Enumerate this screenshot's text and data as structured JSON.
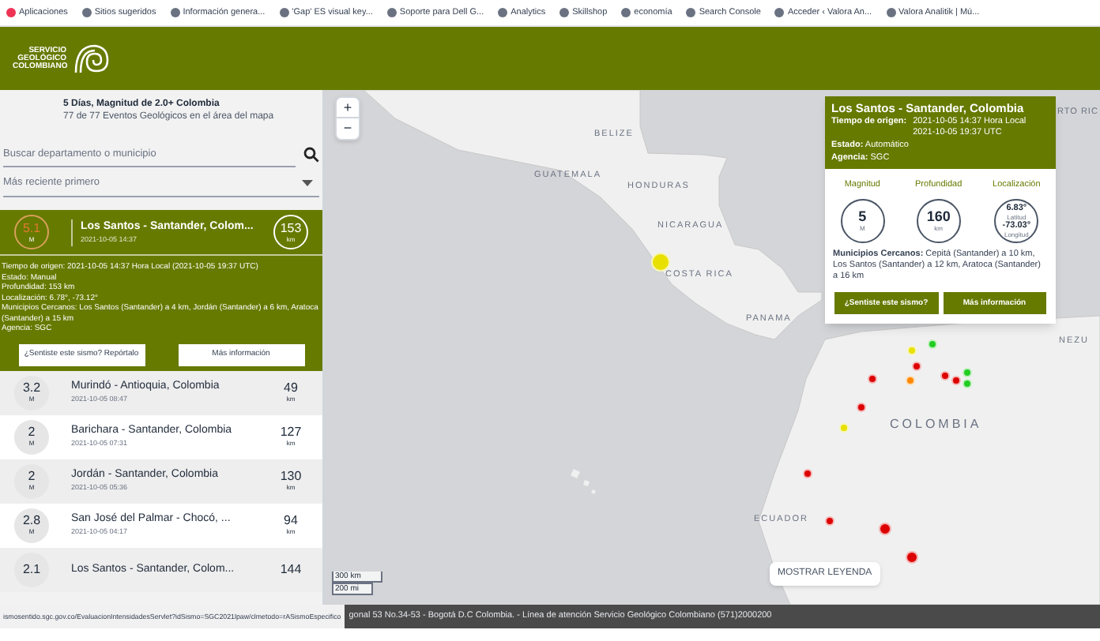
{
  "bookmarks": [
    "Aplicaciones",
    "Sitios sugeridos",
    "Información genera...",
    "'Gap' ES visual key...",
    "Soporte para Dell G...",
    "Analytics",
    "Skillshop",
    "economía",
    "Search Console",
    "Acceder ‹ Valora An...",
    "Valora Analitik | Mú..."
  ],
  "logo_text": "SERVICIO GEOLÓGICO COLOMBIANO",
  "sidebar": {
    "summary_title": "5 Días, Magnitud de 2.0+ Colombia",
    "summary_count": "77 de 77 Eventos Geológicos en el área del mapa",
    "search": {
      "placeholder": "Buscar departamento o municipio"
    },
    "sort": {
      "value": "Más reciente primero"
    },
    "events": [
      {
        "magnitude": "5.1",
        "unit": "M",
        "place": "Los Santos - Santander, Colom...",
        "time": "2021-10-05 14:37",
        "distance": "153",
        "distance_unit": "km",
        "selected": true,
        "details": [
          "Tiempo de origen: 2021-10-05 14:37 Hora Local (2021-10-05 19:37 UTC)",
          "Estado: Manual",
          "Profundidad: 153 km",
          "Localización: 6.78°, -73.12°",
          "Municipios Cercanos: Los Santos (Santander) a 4 km, Jordán (Santander) a 6 km, Aratoca (Santander) a 15 km",
          "Agencia: SGC"
        ],
        "buttons": [
          "¿Sentiste este sismo? Repórtalo",
          "Más información"
        ]
      },
      {
        "magnitude": "3.2",
        "unit": "M",
        "place": "Murindó - Antioquia, Colombia",
        "time": "2021-10-05 08:47",
        "distance": "49",
        "distance_unit": "km",
        "selected": false
      },
      {
        "magnitude": "2",
        "unit": "M",
        "place": "Barichara - Santander, Colombia",
        "time": "2021-10-05 07:31",
        "distance": "127",
        "distance_unit": "km",
        "selected": false
      },
      {
        "magnitude": "2",
        "unit": "M",
        "place": "Jordán - Santander, Colombia",
        "time": "2021-10-05 05:36",
        "distance": "130",
        "distance_unit": "km",
        "selected": false
      },
      {
        "magnitude": "2.8",
        "unit": "M",
        "place": "San José del Palmar - Chocó, ...",
        "time": "2021-10-05 04:17",
        "distance": "94",
        "distance_unit": "km",
        "selected": false
      },
      {
        "magnitude": "2.1",
        "place": "Los Santos - Santander, Colom...",
        "distance": "144",
        "selected": false
      }
    ]
  },
  "map": {
    "zoom_in": "+",
    "zoom_out": "−",
    "labels": [
      "BELIZE",
      "GUATEMALA",
      "HONDURAS",
      "NICARAGUA",
      "COSTA RICA",
      "PANAMA",
      "COLOMBIA",
      "ECUADOR",
      "RTO RIC",
      "NEZU"
    ],
    "markers": [
      {
        "color": "#e8e000"
      },
      {
        "color": "#e8e000"
      },
      {
        "color": "#22cc22"
      },
      {
        "color": "#dd0000"
      },
      {
        "color": "#ff8800"
      },
      {
        "color": "#22cc22"
      },
      {
        "color": "#22cc22"
      },
      {
        "color": "#dd0000"
      },
      {
        "color": "#dd0000"
      },
      {
        "color": "#dd0000"
      },
      {
        "color": "#e8e000"
      },
      {
        "color": "#dd0000"
      },
      {
        "color": "#dd0000"
      },
      {
        "color": "#dd0000"
      },
      {
        "color": "#dd0000"
      },
      {
        "color": "#dd0000"
      }
    ],
    "scale": [
      "300 km",
      "200 mi"
    ],
    "legend_button": "MOSTRAR LEYENDA",
    "popup": {
      "title": "Los Santos - Santander, Colombia",
      "origin_label": "Tiempo de origen:",
      "origin_local": "2021-10-05 14:37 Hora Local",
      "origin_utc": "2021-10-05 19:37 UTC",
      "status": "**Estado:** Automático",
      "agency": "**Agencia:** SGC",
      "stats": [
        {
          "label": "Magnitud",
          "lines": [
            "5",
            "M"
          ]
        },
        {
          "label": "Profundidad",
          "lines": [
            "160",
            "km"
          ]
        },
        {
          "label": "Localización",
          "lines": [
            "6.83°",
            "Latitud",
            "-73.03°",
            "Longitud"
          ]
        }
      ],
      "nearby": "**Municipios Cercanos:** Cepitá (Santander) a 10 km, Los Santos (Santander) a 12 km, Aratoca (Santander) a 16 km",
      "buttons": [
        "¿Sentiste este sismo?",
        "Más información"
      ]
    }
  },
  "status_url": "ismosentido.sgc.gov.co/EvaluacionIntensidadesServlet?idSismo=SGC2021lpaw/clmetodo=rASismoEspecifico",
  "footer": "gonal 53 No.34-53 - Bogotá D.C Colombia. - Línea de atención Servicio Geológico Colombiano (571)2000200"
}
